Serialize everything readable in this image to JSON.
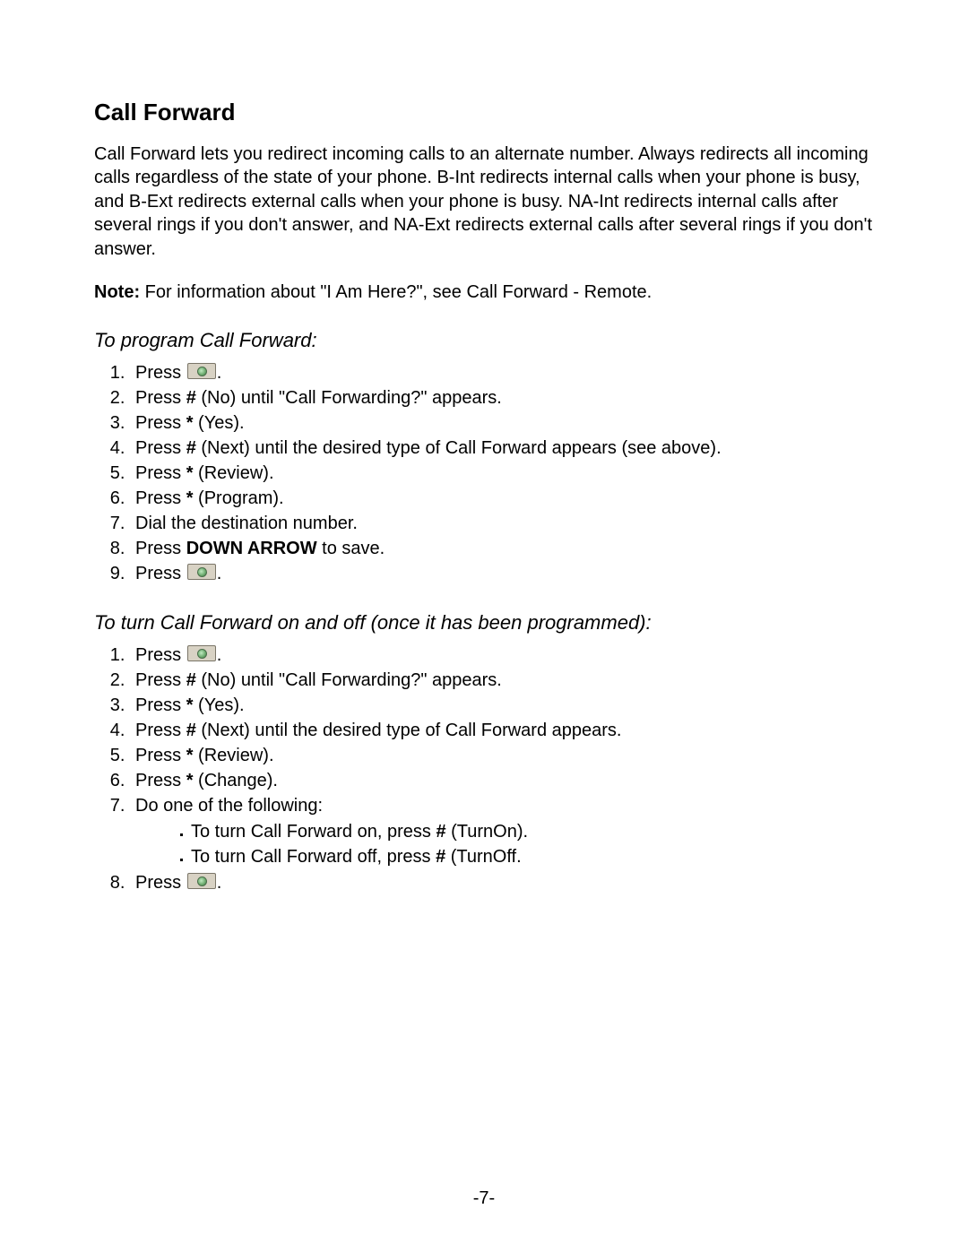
{
  "heading": "Call Forward",
  "intro": "Call Forward lets you redirect incoming calls to an alternate number. Always redirects all incoming calls regardless of the state of your phone. B-Int redirects internal calls when your phone is busy, and B-Ext redirects external calls when your phone is busy. NA-Int redirects internal calls after several rings if you don't answer, and NA-Ext redirects external calls after several rings if you don't answer.",
  "note_label": "Note:",
  "note_text": " For information about \"I Am Here?\", see Call Forward - Remote.",
  "sub1": "To program Call Forward:",
  "list1": {
    "s1_a": "Press ",
    "s1_b": ".",
    "s2_a": "Press ",
    "s2_key": "#",
    "s2_b": " (No) until \"Call Forwarding?\" appears.",
    "s3_a": "Press ",
    "s3_key": "*",
    "s3_b": " (Yes).",
    "s4_a": "Press ",
    "s4_key": "#",
    "s4_b": " (Next) until the desired type of Call Forward appears (see above).",
    "s5_a": "Press ",
    "s5_key": "*",
    "s5_b": " (Review).",
    "s6_a": "Press ",
    "s6_key": "*",
    "s6_b": " (Program).",
    "s7": "Dial the destination number.",
    "s8_a": "Press ",
    "s8_key": "DOWN ARROW",
    "s8_b": " to save.",
    "s9_a": "Press ",
    "s9_b": "."
  },
  "sub2": "To turn Call Forward on and off (once it has been programmed):",
  "list2": {
    "s1_a": "Press ",
    "s1_b": ".",
    "s2_a": "Press ",
    "s2_key": "#",
    "s2_b": " (No) until \"Call Forwarding?\" appears.",
    "s3_a": "Press ",
    "s3_key": "*",
    "s3_b": " (Yes).",
    "s4_a": "Press ",
    "s4_key": "#",
    "s4_b": " (Next) until the desired type of Call Forward appears.",
    "s5_a": "Press ",
    "s5_key": "*",
    "s5_b": " (Review).",
    "s6_a": "Press ",
    "s6_key": "*",
    "s6_b": " (Change).",
    "s7": "Do one of the following:",
    "s7_sub": {
      "a_pre": "To turn Call Forward on, press ",
      "a_key": "#",
      "a_post": " (TurnOn).",
      "b_pre": "To turn Call Forward off, press ",
      "b_key": "#",
      "b_post": " (TurnOff."
    },
    "s8_a": "Press ",
    "s8_b": "."
  },
  "page_number": "-7-"
}
